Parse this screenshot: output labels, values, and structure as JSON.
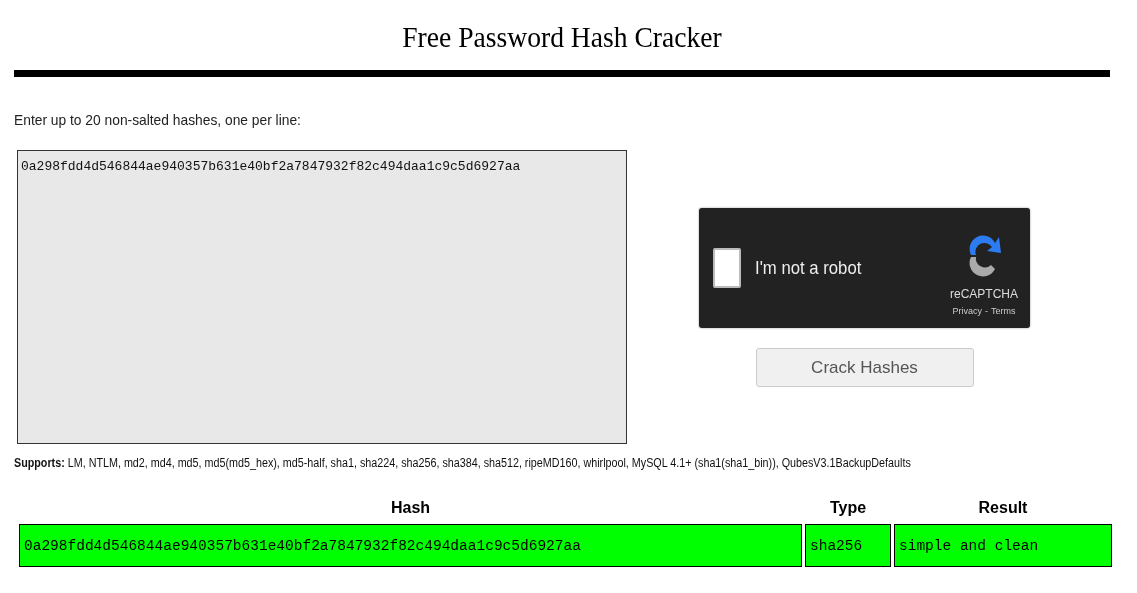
{
  "title": "Free Password Hash Cracker",
  "prompt": "Enter up to 20 non-salted hashes, one per line:",
  "hash_input": {
    "value": "0a298fdd4d546844ae940357b631e40bf2a7847932f82c494daa1c9c5d6927aa"
  },
  "captcha": {
    "label": "I'm not a robot",
    "checked": false,
    "brand": "reCAPTCHA",
    "privacy": "Privacy",
    "separator": "-",
    "terms": "Terms"
  },
  "submit_button": "Crack Hashes",
  "supports": "**Supports:** LM, NTLM, md2, md4, md5, md5(md5_hex), md5-half, sha1, sha224, sha256, sha384, sha512, ripeMD160, whirlpool, MySQL 4.1+ (sha1(sha1_bin)), QubesV3.1BackupDefaults",
  "table": {
    "columns": [
      "Hash",
      "Type",
      "Result"
    ],
    "rows": [
      {
        "cells": [
          "0a298fdd4d546844ae940357b631e40bf2a7847932f82c494daa1c9c5d6927aa",
          "sha256",
          "simple and clean"
        ],
        "color": "#00ff00"
      }
    ]
  }
}
